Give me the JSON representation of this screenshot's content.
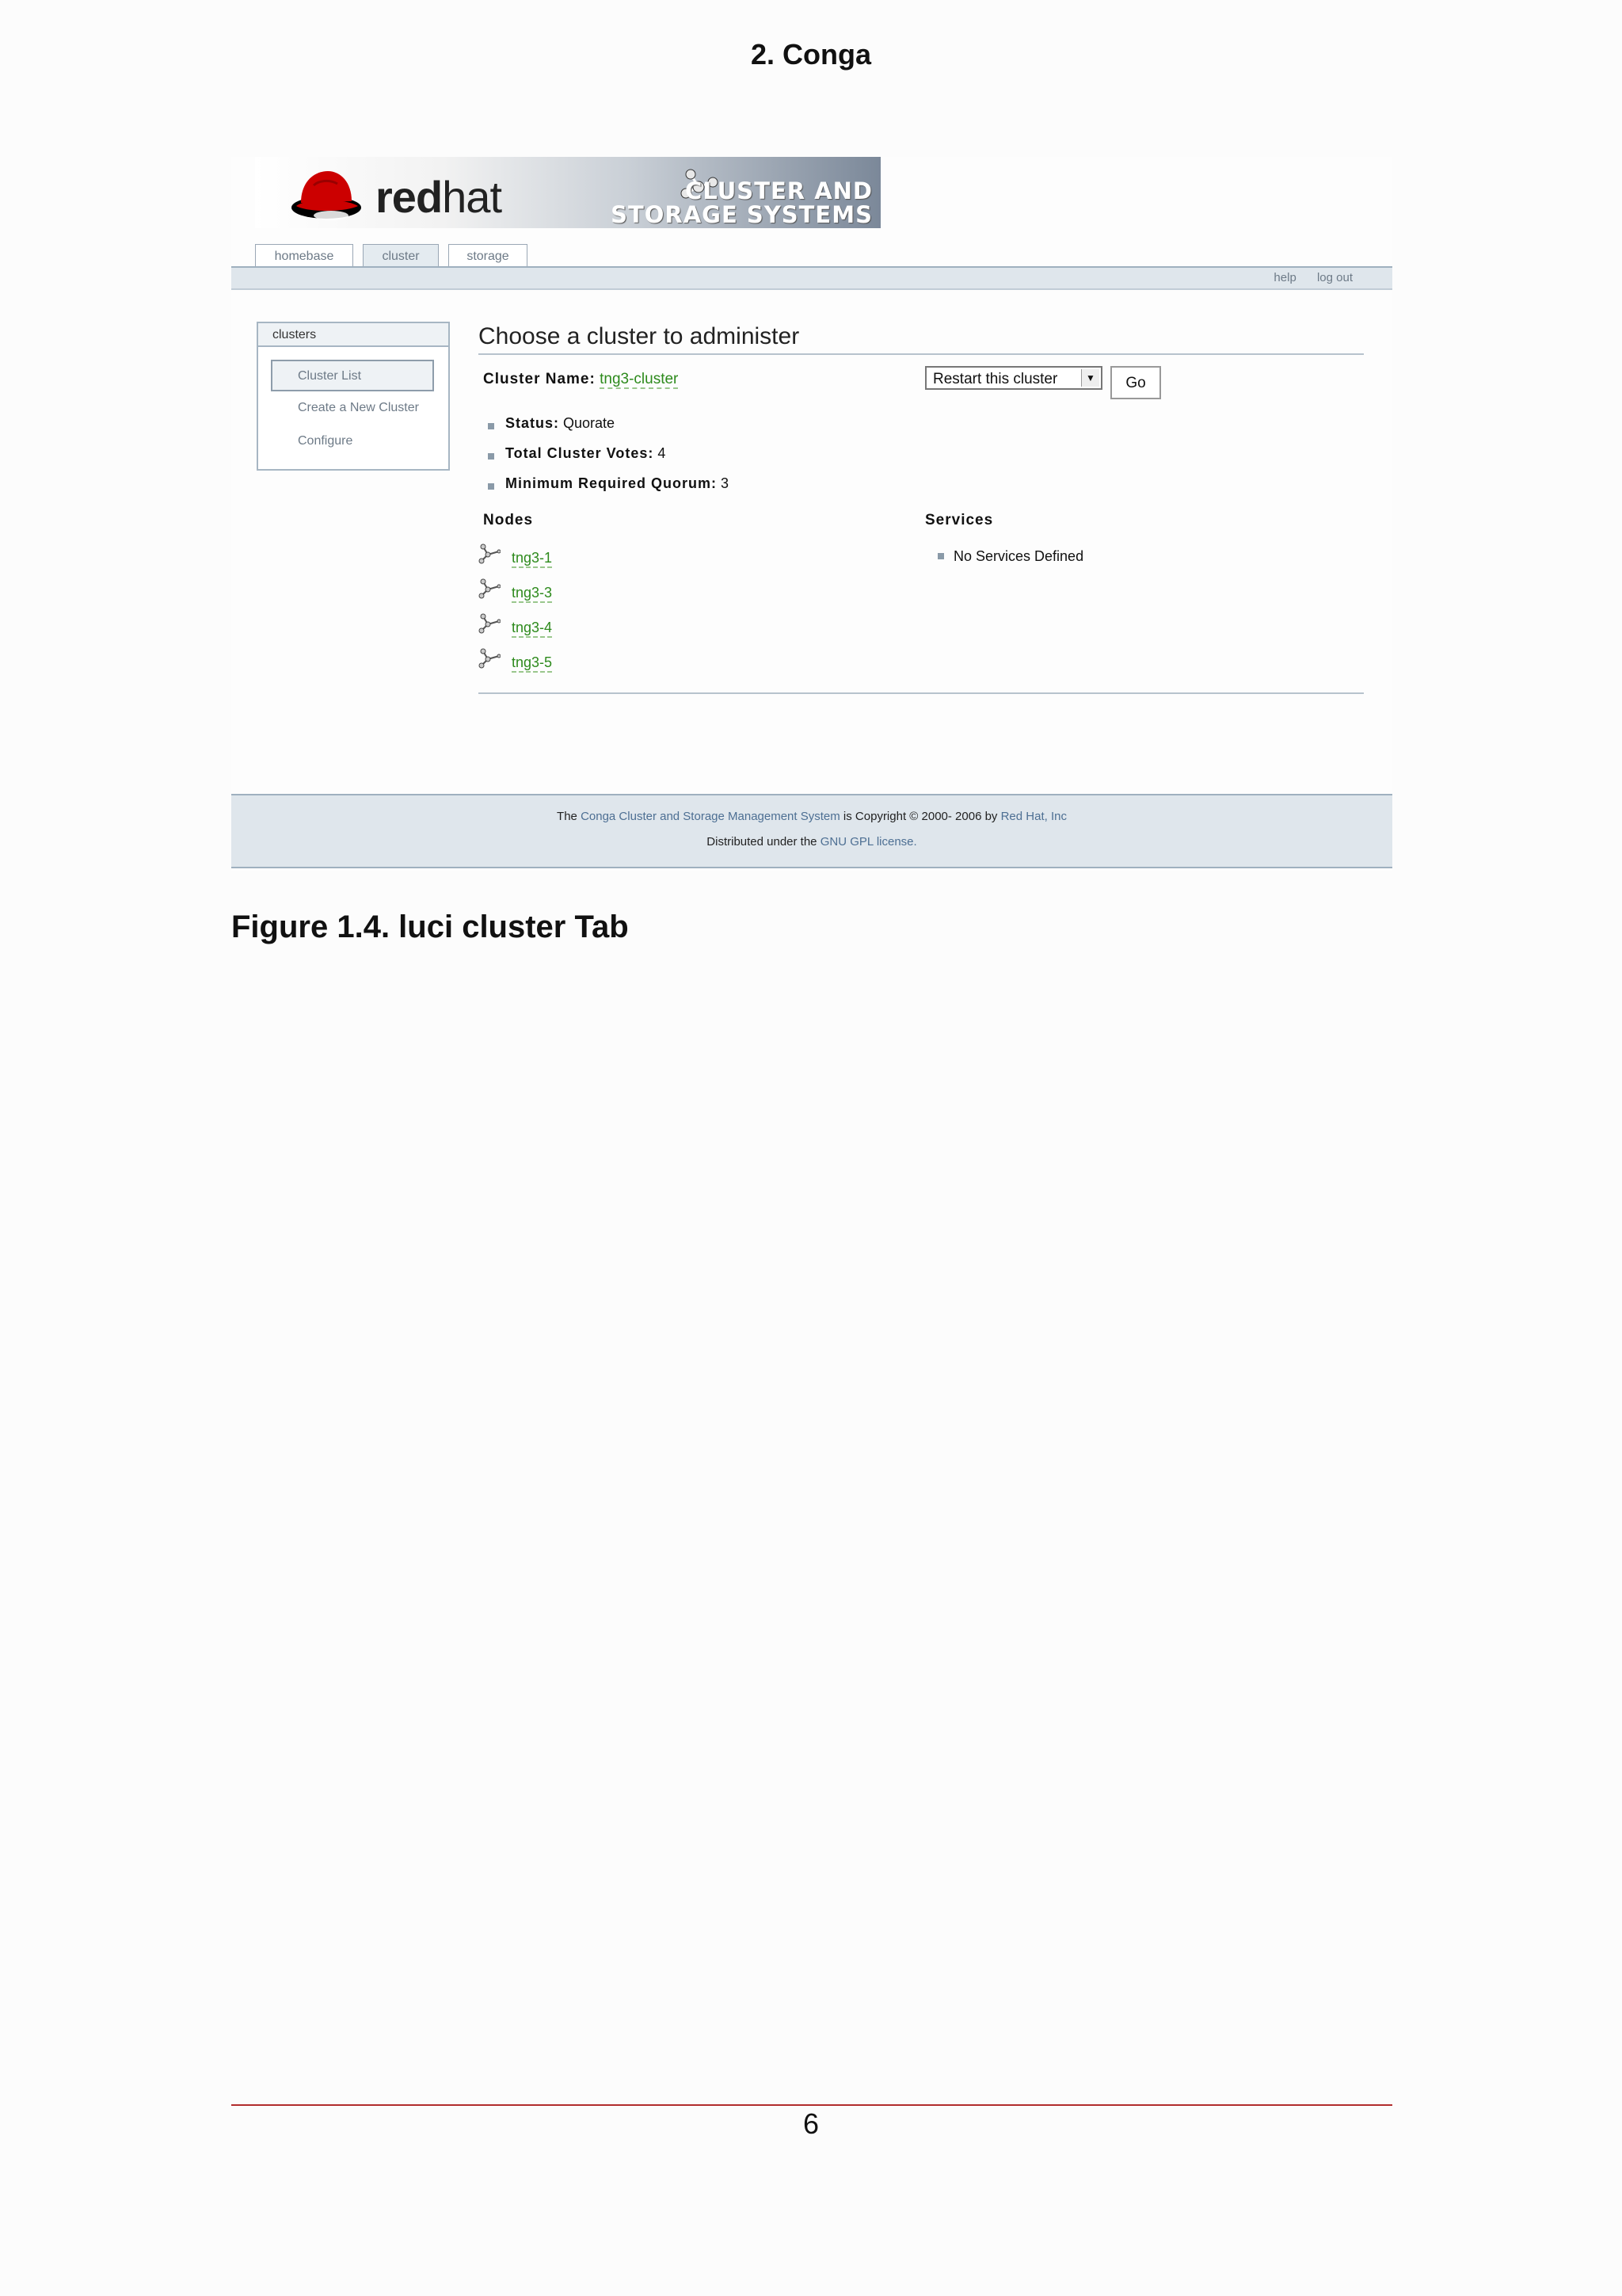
{
  "page_header": "2. Conga",
  "banner": {
    "logo_red": "red",
    "logo_hat": "hat",
    "product_line1": "CLUSTER AND",
    "product_line2": "STORAGE SYSTEMS"
  },
  "tabs": [
    {
      "label": "homebase"
    },
    {
      "label": "cluster"
    },
    {
      "label": "storage"
    }
  ],
  "toplinks": {
    "help": "help",
    "logout": "log out"
  },
  "leftnav": {
    "title": "clusters",
    "items": [
      {
        "label": "Cluster List"
      },
      {
        "label": "Create a New Cluster"
      },
      {
        "label": "Configure"
      }
    ]
  },
  "main": {
    "title": "Choose a cluster to administer",
    "cluster_name_label": "Cluster Name:",
    "cluster_name_value": "tng3-cluster",
    "action_select": "Restart this cluster",
    "go_label": "Go",
    "status_label": "Status:",
    "status_value": "Quorate",
    "votes_label": "Total Cluster Votes:",
    "votes_value": "4",
    "quorum_label": "Minimum Required Quorum:",
    "quorum_value": "3",
    "nodes_heading": "Nodes",
    "nodes": [
      {
        "name": "tng3-1"
      },
      {
        "name": "tng3-3"
      },
      {
        "name": "tng3-4"
      },
      {
        "name": "tng3-5"
      }
    ],
    "services_heading": "Services",
    "services_empty": "No Services Defined"
  },
  "footer": {
    "the": "The",
    "conga_link": "Conga Cluster and Storage Management System",
    "copyright": "is Copyright © 2000- 2006 by",
    "redhat_link": "Red Hat, Inc",
    "distributed": "Distributed under the",
    "gpl_link": "GNU GPL license."
  },
  "caption": "Figure 1.4. luci cluster Tab",
  "page_number": "6",
  "colors": {
    "link_green": "#2d8a1c",
    "redhat_red": "#cc0000",
    "footer_link": "#4d6f93",
    "page_rule": "#b22c2c"
  }
}
